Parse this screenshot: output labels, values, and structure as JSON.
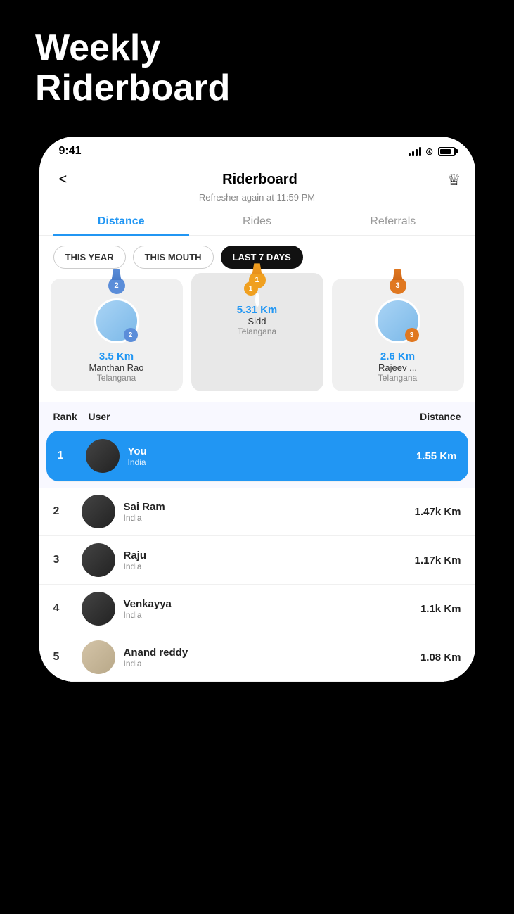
{
  "page": {
    "title": "Weekly\nRiderboard",
    "bg_color": "#000"
  },
  "status_bar": {
    "time": "9:41",
    "signal_label": "signal",
    "wifi_label": "wifi",
    "battery_label": "battery"
  },
  "header": {
    "back_label": "<",
    "title": "Riderboard",
    "subtitle": "Refresher again at 11:59 PM",
    "crown_label": "👑"
  },
  "tabs": [
    {
      "label": "Distance",
      "active": true
    },
    {
      "label": "Rides",
      "active": false
    },
    {
      "label": "Referrals",
      "active": false
    }
  ],
  "filters": [
    {
      "label": "THIS YEAR",
      "active": false
    },
    {
      "label": "THIS MOUTH",
      "active": false
    },
    {
      "label": "LAST 7 DAYS",
      "active": true
    }
  ],
  "podium": [
    {
      "rank": 2,
      "name": "Manthan Rao",
      "region": "Telangana",
      "distance": "3.5 Km",
      "medal_type": "silver",
      "avatar_color": "avatar-blue"
    },
    {
      "rank": 1,
      "name": "Sidd",
      "region": "Telangana",
      "distance": "5.31 Km",
      "medal_type": "gold",
      "avatar_color": "bike-placeholder"
    },
    {
      "rank": 3,
      "name": "Rajeev ...",
      "region": "Telangana",
      "distance": "2.6 Km",
      "medal_type": "bronze",
      "avatar_color": "avatar-blue"
    }
  ],
  "table_headers": {
    "rank": "Rank",
    "user": "User",
    "distance": "Distance"
  },
  "leaderboard": [
    {
      "rank": "1",
      "name": "You",
      "region": "India",
      "distance": "1.55 Km",
      "highlighted": true,
      "avatar_color": "avatar-dark"
    },
    {
      "rank": "2",
      "name": "Sai Ram",
      "region": "India",
      "distance": "1.47k Km",
      "highlighted": false,
      "avatar_color": "avatar-dark"
    },
    {
      "rank": "3",
      "name": "Raju",
      "region": "India",
      "distance": "1.17k Km",
      "highlighted": false,
      "avatar_color": "avatar-dark"
    },
    {
      "rank": "4",
      "name": "Venkayya",
      "region": "India",
      "distance": "1.1k Km",
      "highlighted": false,
      "avatar_color": "avatar-dark"
    },
    {
      "rank": "5",
      "name": "Anand reddy",
      "region": "India",
      "distance": "1.08 Km",
      "highlighted": false,
      "avatar_color": "avatar-light"
    }
  ]
}
